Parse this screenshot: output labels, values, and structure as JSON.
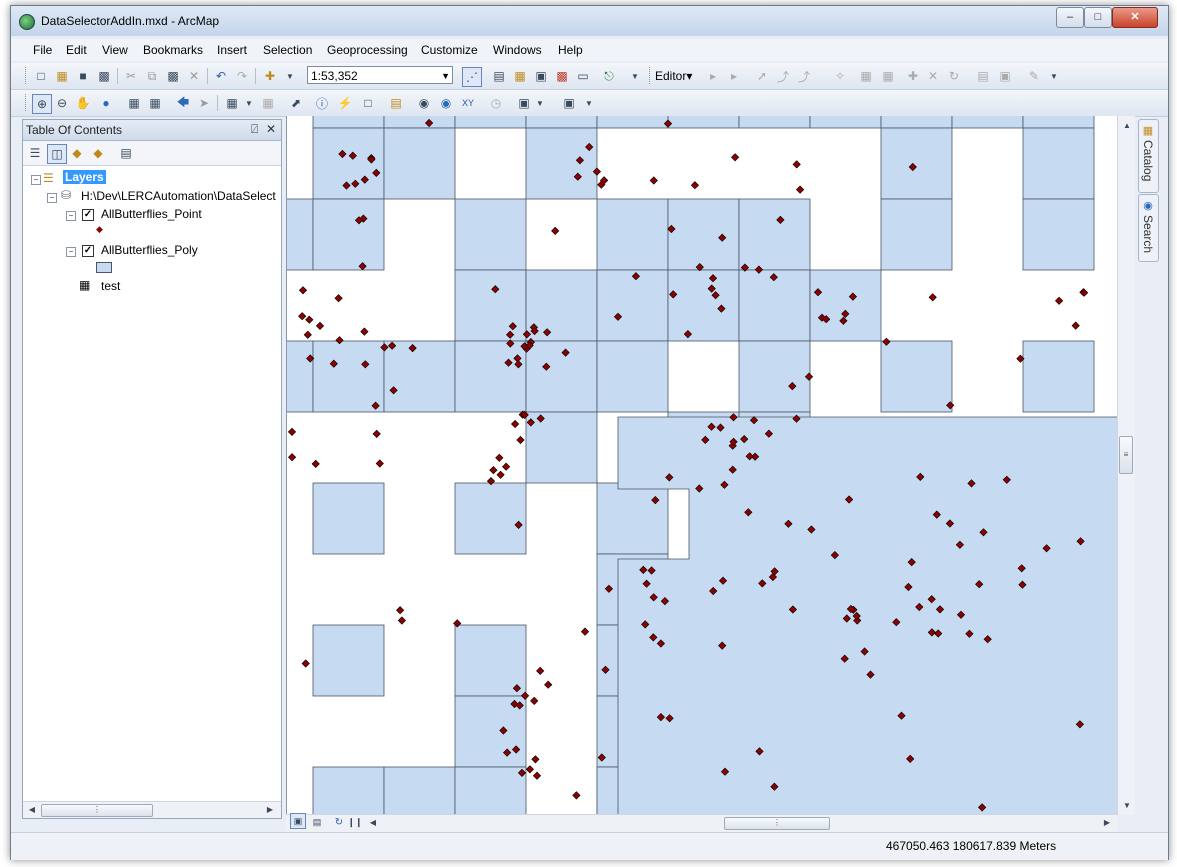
{
  "window": {
    "title": "DataSelectorAddIn.mxd - ArcMap",
    "controls": [
      "–",
      "□",
      "✕"
    ]
  },
  "menu": [
    "File",
    "Edit",
    "View",
    "Bookmarks",
    "Insert",
    "Selection",
    "Geoprocessing",
    "Customize",
    "Windows",
    "Help"
  ],
  "toolbar": {
    "scale": "1:53,352",
    "editor_label": "Editor▾"
  },
  "toc": {
    "title": "Table Of Contents",
    "pin": "2",
    "close": "✕",
    "layers_label": "Layers",
    "datasource_label": "H:\\Dev\\LERCAutomation\\DataSelect",
    "layer_point": "AllButterflies_Point",
    "layer_poly": "AllButterflies_Poly",
    "table_name": "test",
    "point_checked": true,
    "poly_checked": true
  },
  "side_tabs": [
    "Catalog",
    "Search"
  ],
  "status": {
    "coordinates": "467050.463  180617.839 Meters"
  },
  "colors": {
    "polygon_fill": "#c6daf2",
    "polygon_stroke": "#4a5566",
    "point_fill": "#8b0000",
    "selection_highlight": "#3399ff"
  }
}
